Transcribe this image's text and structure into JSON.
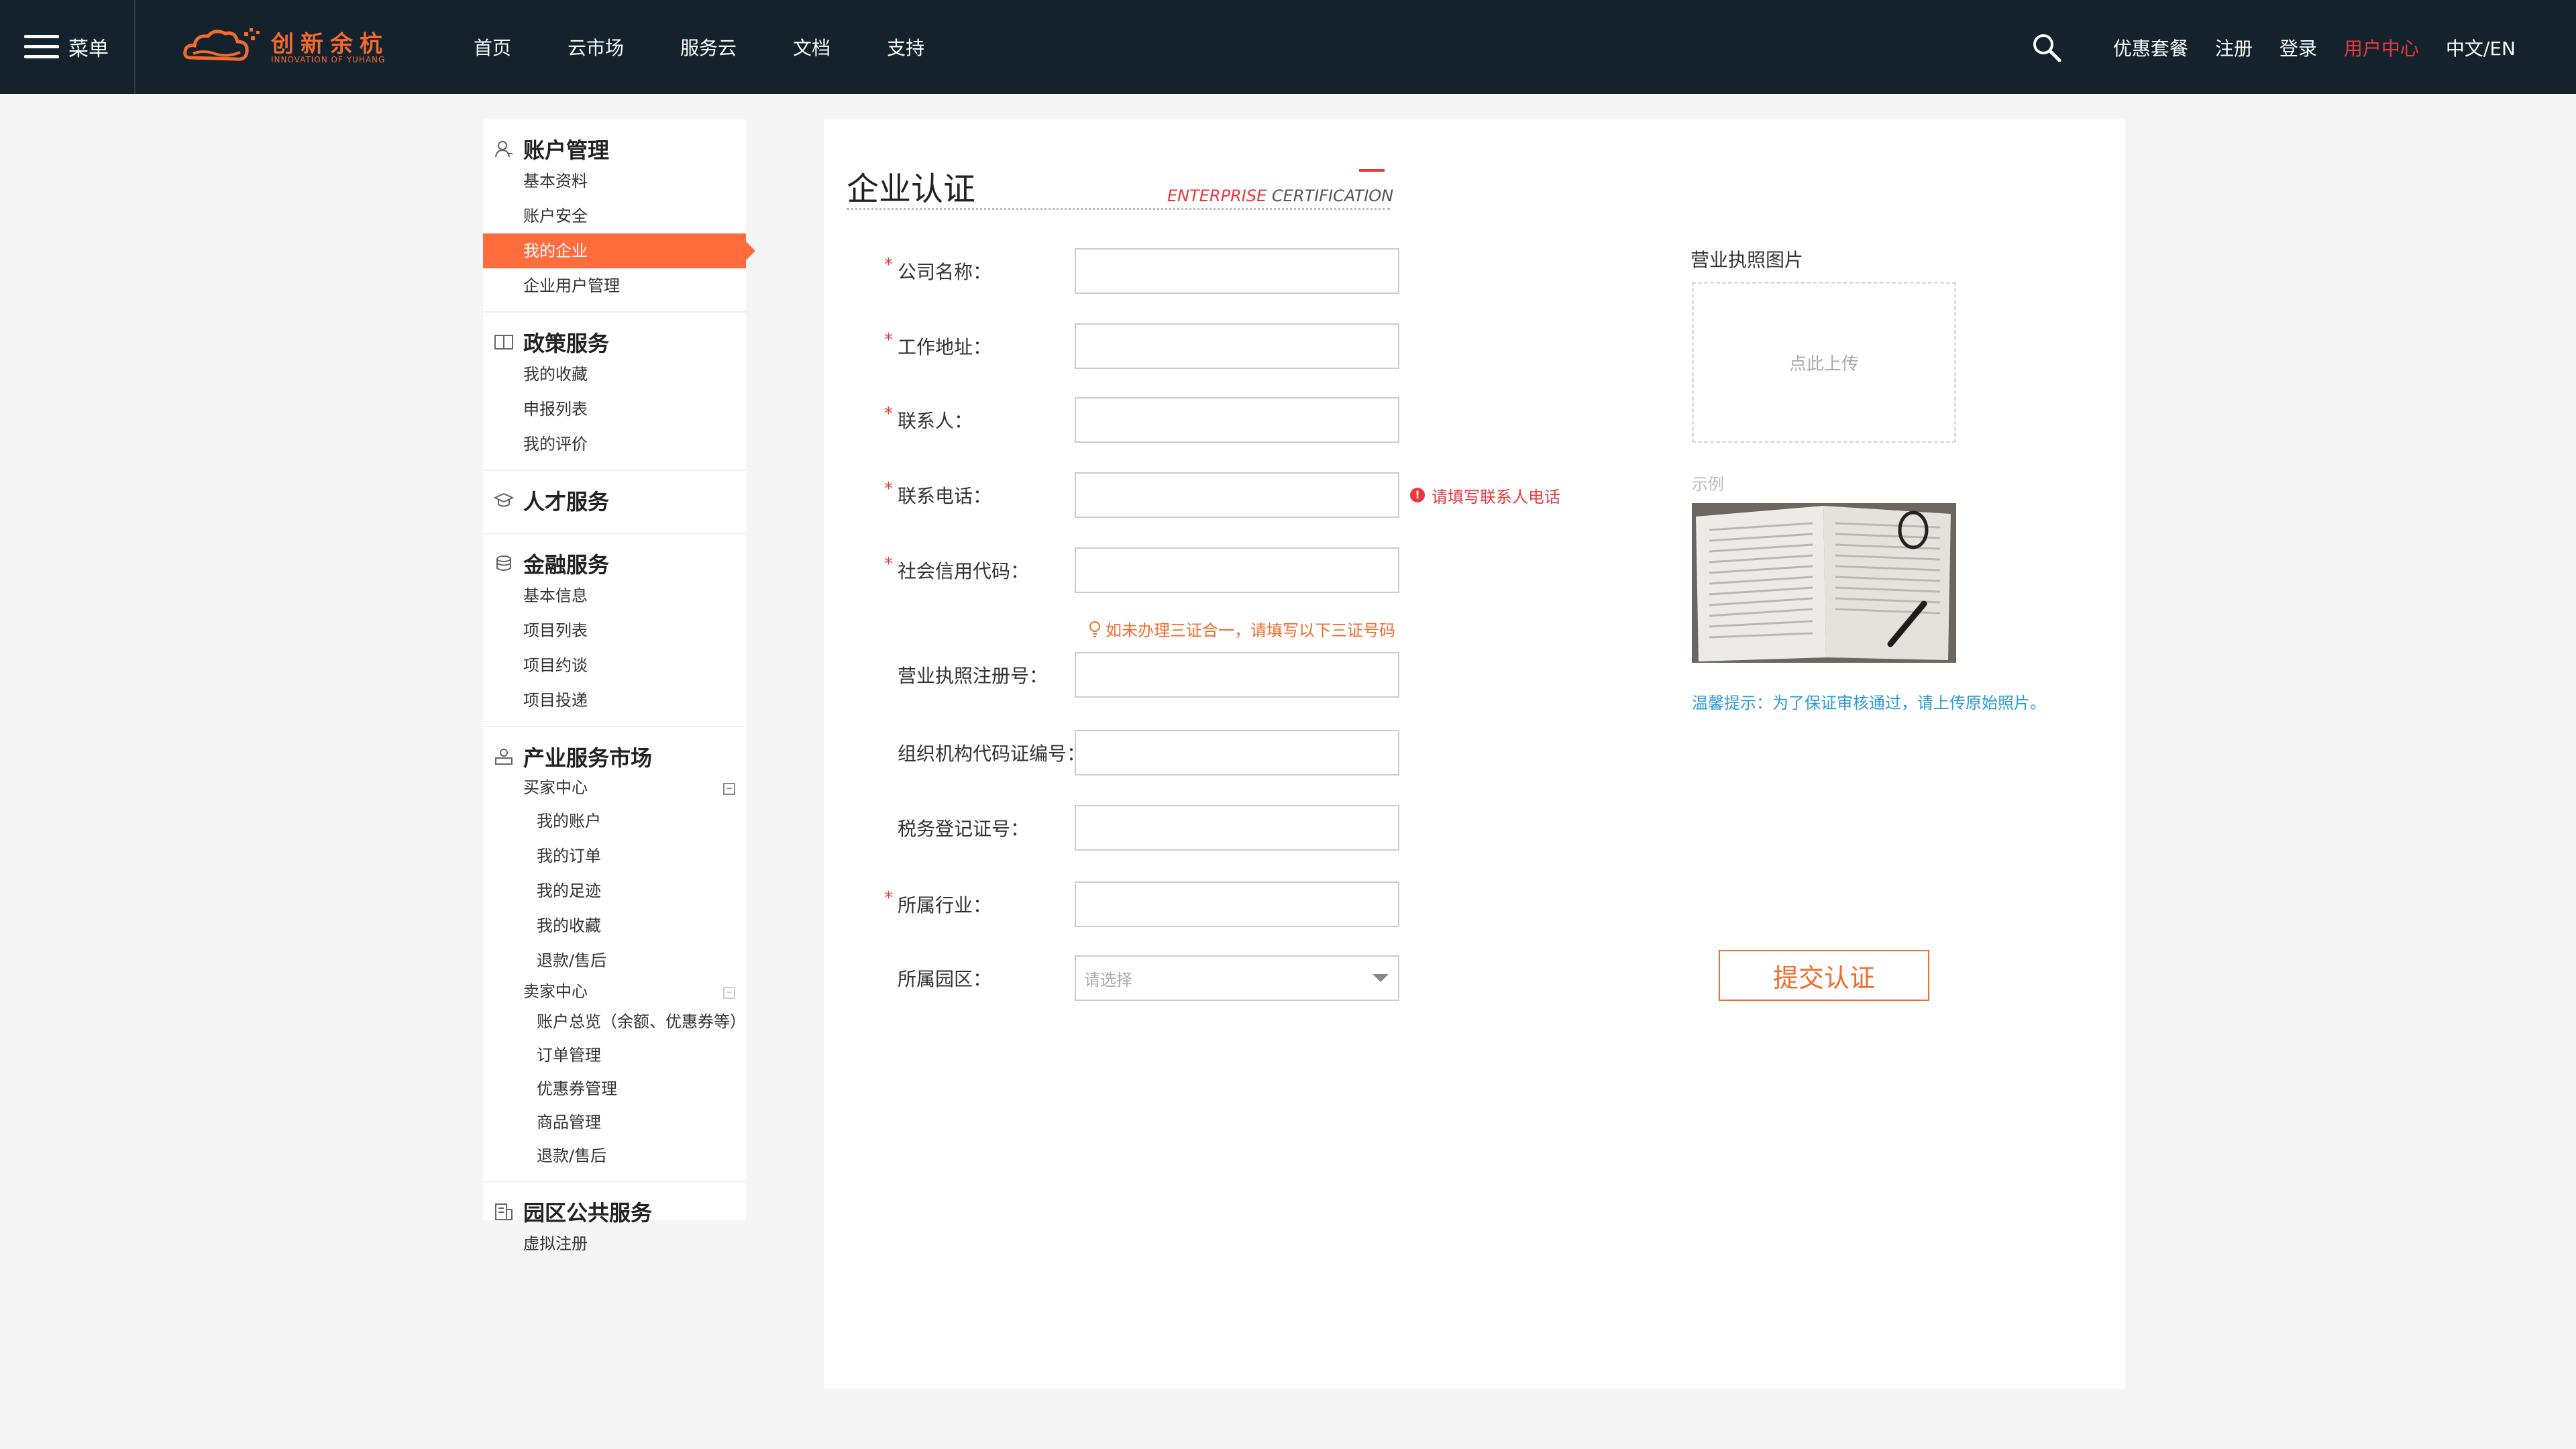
{
  "header": {
    "menu_label": "菜单",
    "logo_title": "创新余杭",
    "logo_subtitle": "INNOVATION OF YUHANG",
    "nav": [
      "首页",
      "云市场",
      "服务云",
      "文档",
      "支持"
    ],
    "right_links": [
      "优惠套餐",
      "注册",
      "登录",
      "用户中心",
      "中文/EN"
    ],
    "active_link": "用户中心"
  },
  "sidebar": {
    "groups": [
      {
        "title": "账户管理",
        "icon": "user-icon",
        "items": [
          "基本资料",
          "账户安全",
          "我的企业",
          "企业用户管理"
        ],
        "active": "我的企业"
      },
      {
        "title": "政策服务",
        "icon": "book-icon",
        "items": [
          "我的收藏",
          "申报列表",
          "我的评价"
        ]
      },
      {
        "title": "人才服务",
        "icon": "graduation-cap-icon",
        "items": []
      },
      {
        "title": "金融服务",
        "icon": "coins-icon",
        "items": [
          "基本信息",
          "项目列表",
          "项目约谈",
          "项目投递"
        ]
      },
      {
        "title": "产业服务市场",
        "icon": "shop-icon",
        "buyer": {
          "label": "买家中心",
          "items": [
            "我的账户",
            "我的订单",
            "我的足迹",
            "我的收藏",
            "退款/售后"
          ]
        },
        "seller": {
          "label": "卖家中心",
          "items": [
            "账户总览（余额、优惠券等）",
            "订单管理",
            "优惠券管理",
            "商品管理",
            "退款/售后"
          ]
        }
      },
      {
        "title": "园区公共服务",
        "icon": "building-icon",
        "items": [
          "虚拟注册"
        ]
      }
    ]
  },
  "main": {
    "title": "企业认证",
    "title_en_red": "ENTERPRISE",
    "title_en_rest": " CERTIFICATION",
    "fields": [
      {
        "label": "公司名称：",
        "required": true,
        "value": ""
      },
      {
        "label": "工作地址：",
        "required": true,
        "value": ""
      },
      {
        "label": "联系人：",
        "required": true,
        "value": ""
      },
      {
        "label": "联系电话：",
        "required": true,
        "value": "",
        "error": "请填写联系人电话"
      },
      {
        "label": "社会信用代码：",
        "required": true,
        "value": ""
      },
      {
        "label": "营业执照注册号：",
        "required": false,
        "value": ""
      },
      {
        "label": "组织机构代码证编号：",
        "required": false,
        "value": ""
      },
      {
        "label": "税务登记证号：",
        "required": false,
        "value": ""
      },
      {
        "label": "所属行业：",
        "required": true,
        "value": ""
      },
      {
        "label": "所属园区：",
        "required": false,
        "placeholder": "请选择"
      }
    ],
    "hint": "如未办理三证合一，请填写以下三证号码",
    "upload_label": "营业执照图片",
    "upload_text": "点此上传",
    "example_label": "示例",
    "tip": "温馨提示：为了保证审核通过，请上传原始照片。",
    "submit_label": "提交认证"
  },
  "colors": {
    "topbar": "#13222d",
    "accent": "#ff6c3e",
    "logo": "#f26b2d",
    "error": "#e8383d",
    "tip": "#2a9ad6"
  }
}
